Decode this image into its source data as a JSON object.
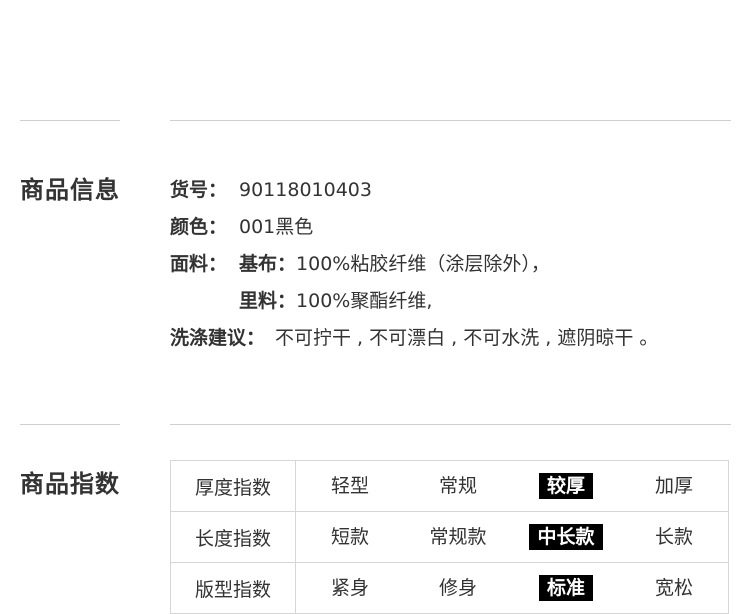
{
  "product_info": {
    "title": "商品信息",
    "item_no_label": "货号：",
    "item_no": "90118010403",
    "color_label": "颜色：",
    "color": "001黑色",
    "fabric_label": "面料：",
    "base_label": "基布：",
    "base_value": "100%粘胶纤维（涂层除外），",
    "lining_label": "里料：",
    "lining_value": "100%聚酯纤维,",
    "wash_label": "洗涤建议：",
    "wash_value": "不可拧干 , 不可漂白 , 不可水洗 , 遮阴晾干 。"
  },
  "product_index": {
    "title": "商品指数",
    "rows": [
      {
        "name": "厚度指数",
        "options": [
          "轻型",
          "常规",
          "较厚",
          "加厚"
        ],
        "selected": "较厚"
      },
      {
        "name": "长度指数",
        "options": [
          "短款",
          "常规款",
          "中长款",
          "长款"
        ],
        "selected": "中长款"
      },
      {
        "name": "版型指数",
        "options": [
          "紧身",
          "修身",
          "标准",
          "宽松"
        ],
        "selected": "标准"
      }
    ]
  },
  "colors": {
    "text": "#333333",
    "rule": "#cfcfcf",
    "selected_bg": "#000000",
    "selected_text": "#ffffff"
  }
}
